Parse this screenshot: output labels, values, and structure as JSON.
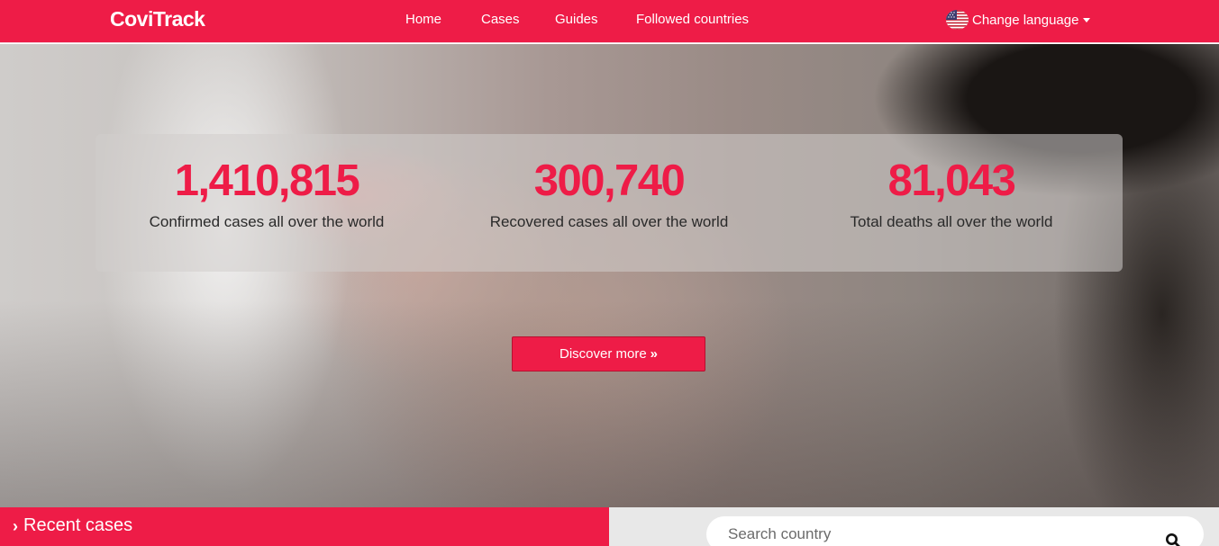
{
  "navbar": {
    "brand": "CoviTrack",
    "links": [
      "Home",
      "Cases",
      "Guides",
      "Followed countries"
    ],
    "language_label": "Change language",
    "flag_icon": "us-flag-icon"
  },
  "colors": {
    "accent": "#ee1c47",
    "stat_panel": "#d2cdcc"
  },
  "hero": {
    "stats": [
      {
        "value": "1,410,815",
        "label": "Confirmed cases all over the world"
      },
      {
        "value": "300,740",
        "label": "Recovered cases all over the world"
      },
      {
        "value": "81,043",
        "label": "Total deaths all over the world"
      }
    ],
    "cta_label": "Discover more",
    "cta_icon": "double-chevron-right-icon"
  },
  "recent": {
    "title": "Recent cases",
    "icon": "chevron-right-icon"
  },
  "search": {
    "placeholder": "Search country",
    "icon": "search-icon"
  }
}
